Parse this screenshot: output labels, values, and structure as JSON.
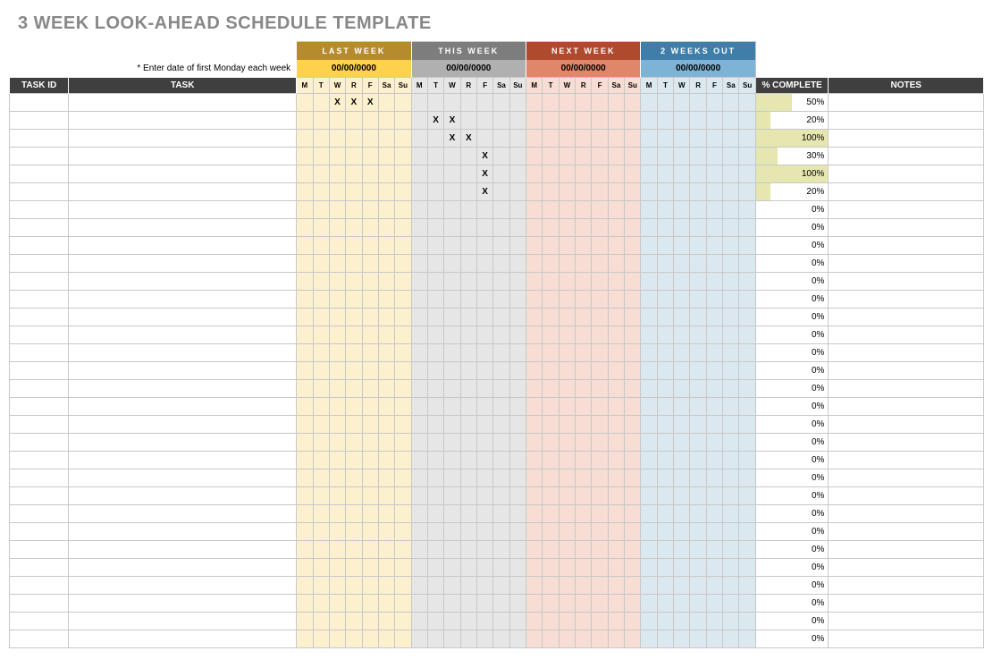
{
  "title": "3 WEEK LOOK-AHEAD SCHEDULE TEMPLATE",
  "instruction": "* Enter date of first Monday each week",
  "weeks": [
    {
      "label": "LAST WEEK",
      "date": "00/00/0000",
      "hdrClass": "wk-lw-h",
      "dateClass": "wk-lw-d",
      "bg": "bg-lw"
    },
    {
      "label": "THIS WEEK",
      "date": "00/00/0000",
      "hdrClass": "wk-tw-h",
      "dateClass": "wk-tw-d",
      "bg": "bg-tw"
    },
    {
      "label": "NEXT WEEK",
      "date": "00/00/0000",
      "hdrClass": "wk-nw-h",
      "dateClass": "wk-nw-d",
      "bg": "bg-nw"
    },
    {
      "label": "2 WEEKS OUT",
      "date": "00/00/0000",
      "hdrClass": "wk-2w-h",
      "dateClass": "wk-2w-d",
      "bg": "bg-2w"
    }
  ],
  "days": [
    "M",
    "T",
    "W",
    "R",
    "F",
    "Sa",
    "Su"
  ],
  "columns": {
    "taskId": "TASK ID",
    "task": "TASK",
    "pct": "% COMPLETE",
    "notes": "NOTES"
  },
  "rows": [
    {
      "taskId": "",
      "task": "",
      "marks": {
        "0": [
          2,
          3,
          4
        ]
      },
      "pct": 50,
      "notes": ""
    },
    {
      "taskId": "",
      "task": "",
      "marks": {
        "1": [
          1,
          2
        ]
      },
      "pct": 20,
      "notes": ""
    },
    {
      "taskId": "",
      "task": "",
      "marks": {
        "1": [
          2,
          3
        ]
      },
      "pct": 100,
      "notes": ""
    },
    {
      "taskId": "",
      "task": "",
      "marks": {
        "1": [
          4
        ]
      },
      "pct": 30,
      "notes": ""
    },
    {
      "taskId": "",
      "task": "",
      "marks": {
        "1": [
          4
        ]
      },
      "pct": 100,
      "notes": ""
    },
    {
      "taskId": "",
      "task": "",
      "marks": {
        "1": [
          4
        ]
      },
      "pct": 20,
      "notes": ""
    },
    {
      "taskId": "",
      "task": "",
      "marks": {},
      "pct": 0,
      "notes": ""
    },
    {
      "taskId": "",
      "task": "",
      "marks": {},
      "pct": 0,
      "notes": ""
    },
    {
      "taskId": "",
      "task": "",
      "marks": {},
      "pct": 0,
      "notes": ""
    },
    {
      "taskId": "",
      "task": "",
      "marks": {},
      "pct": 0,
      "notes": ""
    },
    {
      "taskId": "",
      "task": "",
      "marks": {},
      "pct": 0,
      "notes": ""
    },
    {
      "taskId": "",
      "task": "",
      "marks": {},
      "pct": 0,
      "notes": ""
    },
    {
      "taskId": "",
      "task": "",
      "marks": {},
      "pct": 0,
      "notes": ""
    },
    {
      "taskId": "",
      "task": "",
      "marks": {},
      "pct": 0,
      "notes": ""
    },
    {
      "taskId": "",
      "task": "",
      "marks": {},
      "pct": 0,
      "notes": ""
    },
    {
      "taskId": "",
      "task": "",
      "marks": {},
      "pct": 0,
      "notes": ""
    },
    {
      "taskId": "",
      "task": "",
      "marks": {},
      "pct": 0,
      "notes": ""
    },
    {
      "taskId": "",
      "task": "",
      "marks": {},
      "pct": 0,
      "notes": ""
    },
    {
      "taskId": "",
      "task": "",
      "marks": {},
      "pct": 0,
      "notes": ""
    },
    {
      "taskId": "",
      "task": "",
      "marks": {},
      "pct": 0,
      "notes": ""
    },
    {
      "taskId": "",
      "task": "",
      "marks": {},
      "pct": 0,
      "notes": ""
    },
    {
      "taskId": "",
      "task": "",
      "marks": {},
      "pct": 0,
      "notes": ""
    },
    {
      "taskId": "",
      "task": "",
      "marks": {},
      "pct": 0,
      "notes": ""
    },
    {
      "taskId": "",
      "task": "",
      "marks": {},
      "pct": 0,
      "notes": ""
    },
    {
      "taskId": "",
      "task": "",
      "marks": {},
      "pct": 0,
      "notes": ""
    },
    {
      "taskId": "",
      "task": "",
      "marks": {},
      "pct": 0,
      "notes": ""
    },
    {
      "taskId": "",
      "task": "",
      "marks": {},
      "pct": 0,
      "notes": ""
    },
    {
      "taskId": "",
      "task": "",
      "marks": {},
      "pct": 0,
      "notes": ""
    },
    {
      "taskId": "",
      "task": "",
      "marks": {},
      "pct": 0,
      "notes": ""
    },
    {
      "taskId": "",
      "task": "",
      "marks": {},
      "pct": 0,
      "notes": ""
    },
    {
      "taskId": "",
      "task": "",
      "marks": {},
      "pct": 0,
      "notes": ""
    }
  ]
}
